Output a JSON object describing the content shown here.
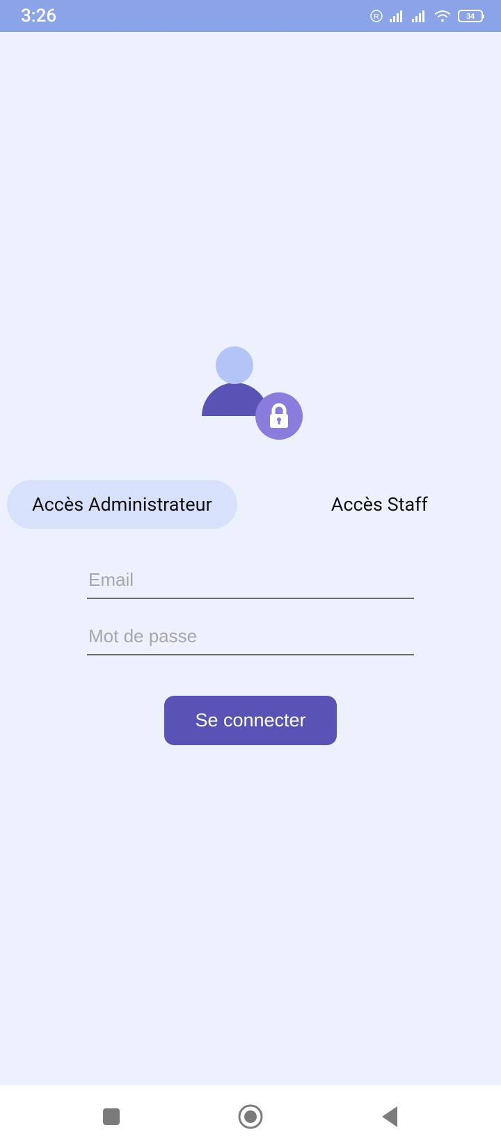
{
  "status": {
    "time": "3:26",
    "battery": "34"
  },
  "tabs": {
    "admin": "Accès Administrateur",
    "staff": "Accès Staff"
  },
  "form": {
    "email_placeholder": "Email",
    "password_placeholder": "Mot de passe",
    "submit_label": "Se connecter"
  }
}
